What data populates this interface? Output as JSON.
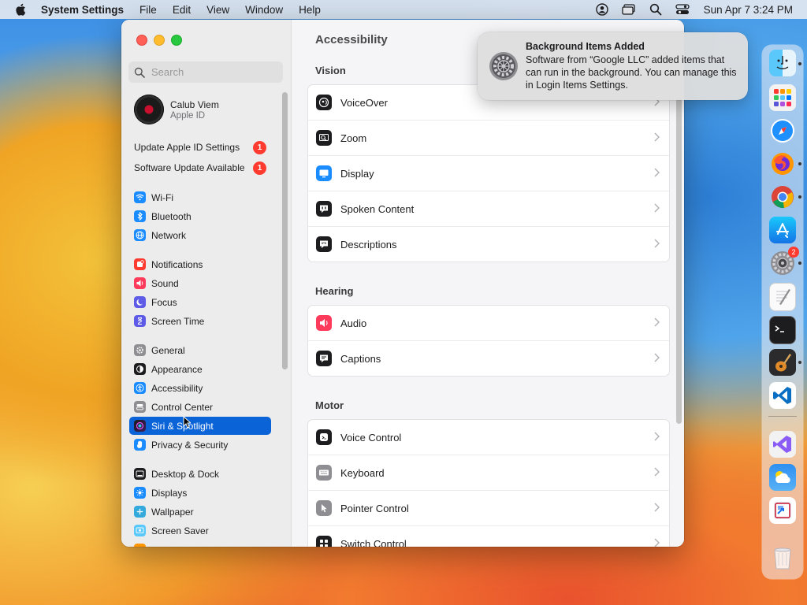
{
  "menubar": {
    "app_name": "System Settings",
    "menus": [
      "File",
      "Edit",
      "View",
      "Window",
      "Help"
    ],
    "clock": "Sun Apr 7  3:24 PM"
  },
  "sidebar": {
    "search_placeholder": "Search",
    "profile": {
      "name": "Calub Viem",
      "subtitle": "Apple ID"
    },
    "alerts": [
      {
        "label": "Update Apple ID Settings",
        "badge": "1"
      },
      {
        "label": "Software Update Available",
        "badge": "1"
      }
    ],
    "items": [
      {
        "label": "Wi-Fi",
        "color": "#1a8cff"
      },
      {
        "label": "Bluetooth",
        "color": "#1a8cff"
      },
      {
        "label": "Network",
        "color": "#1a8cff"
      },
      {
        "label": "Notifications",
        "color": "#ff3b30"
      },
      {
        "label": "Sound",
        "color": "#ff3b5c"
      },
      {
        "label": "Focus",
        "color": "#5e5ce6"
      },
      {
        "label": "Screen Time",
        "color": "#5e5ce6"
      },
      {
        "label": "General",
        "color": "#8e8e93"
      },
      {
        "label": "Appearance",
        "color": "#1d1d1f"
      },
      {
        "label": "Accessibility",
        "color": "#1a8cff"
      },
      {
        "label": "Control Center",
        "color": "#8e8e93"
      },
      {
        "label": "Siri & Spotlight",
        "color": "#b14fe0"
      },
      {
        "label": "Privacy & Security",
        "color": "#1a8cff"
      },
      {
        "label": "Desktop & Dock",
        "color": "#1d1d1f"
      },
      {
        "label": "Displays",
        "color": "#1a8cff"
      },
      {
        "label": "Wallpaper",
        "color": "#34aadc"
      },
      {
        "label": "Screen Saver",
        "color": "#5ac8fa"
      }
    ],
    "selected_index": 11
  },
  "content": {
    "title": "Accessibility",
    "sections": [
      {
        "title": "Vision",
        "rows": [
          {
            "label": "VoiceOver",
            "icon": "voiceover-icon",
            "color": "#1d1d1f"
          },
          {
            "label": "Zoom",
            "icon": "zoom-icon",
            "color": "#1d1d1f"
          },
          {
            "label": "Display",
            "icon": "display-icon",
            "color": "#1a8cff"
          },
          {
            "label": "Spoken Content",
            "icon": "spoken-content-icon",
            "color": "#1d1d1f"
          },
          {
            "label": "Descriptions",
            "icon": "descriptions-icon",
            "color": "#1d1d1f"
          }
        ]
      },
      {
        "title": "Hearing",
        "rows": [
          {
            "label": "Audio",
            "icon": "audio-icon",
            "color": "#ff3b5c"
          },
          {
            "label": "Captions",
            "icon": "captions-icon",
            "color": "#1d1d1f"
          }
        ]
      },
      {
        "title": "Motor",
        "rows": [
          {
            "label": "Voice Control",
            "icon": "voice-control-icon",
            "color": "#1d1d1f"
          },
          {
            "label": "Keyboard",
            "icon": "keyboard-icon",
            "color": "#8e8e93"
          },
          {
            "label": "Pointer Control",
            "icon": "pointer-control-icon",
            "color": "#8e8e93"
          },
          {
            "label": "Switch Control",
            "icon": "switch-control-icon",
            "color": "#1d1d1f"
          }
        ]
      }
    ]
  },
  "notification": {
    "title": "Background Items Added",
    "body": "Software from “Google LLC” added items that can run in the background. You can manage this in Login Items Settings."
  },
  "dock": {
    "apps": [
      {
        "name": "finder-icon"
      },
      {
        "name": "launchpad-icon"
      },
      {
        "name": "safari-icon"
      },
      {
        "name": "firefox-icon"
      },
      {
        "name": "chrome-icon"
      },
      {
        "name": "app-store-icon"
      },
      {
        "name": "system-settings-icon",
        "badge": "2"
      },
      {
        "name": "textedit-icon"
      },
      {
        "name": "terminal-icon"
      },
      {
        "name": "garageband-icon"
      },
      {
        "name": "vscode-icon"
      },
      {
        "name": "visual-studio-icon"
      },
      {
        "name": "weather-icon"
      },
      {
        "name": "remote-desktop-icon"
      },
      {
        "name": "trash-icon"
      }
    ]
  }
}
